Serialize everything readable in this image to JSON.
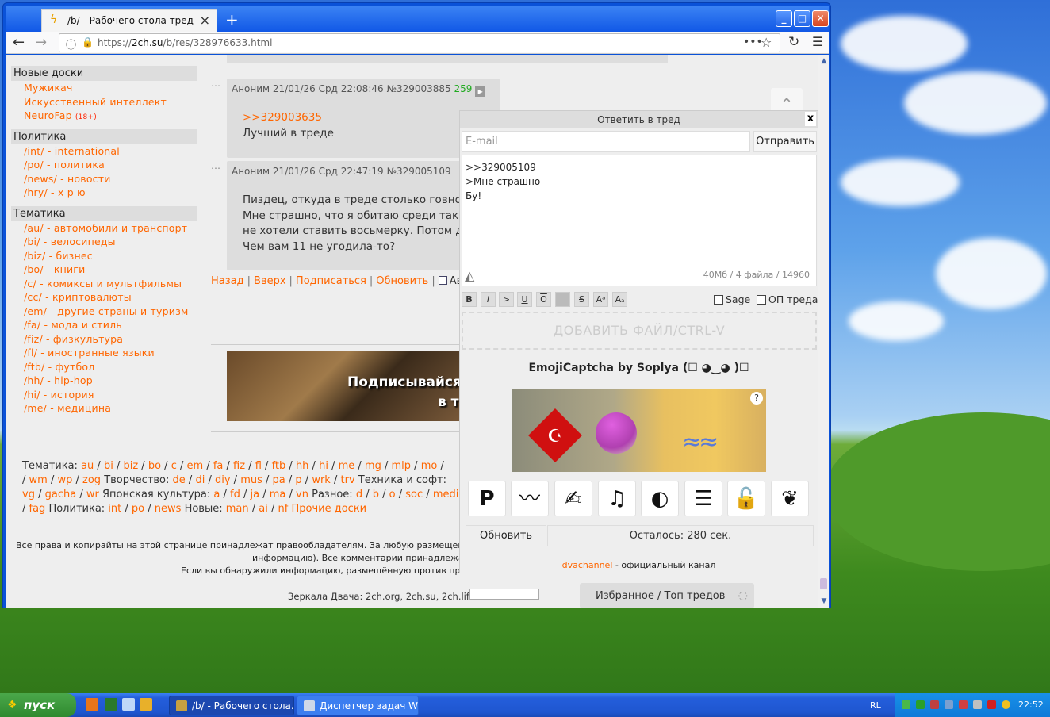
{
  "browser": {
    "tab_title": "/b/ - Рабочего стола тред",
    "url_prefix": "https://",
    "url_host": "2ch.su",
    "url_path": "/b/res/328976633.html"
  },
  "sidebar": {
    "sections": [
      {
        "title": "Новые доски",
        "items": [
          "Мужикач",
          "Искусственный интеллект",
          "NeuroFap"
        ],
        "badge": "(18+)"
      },
      {
        "title": "Политика",
        "items": [
          "/int/ - international",
          "/po/ - политика",
          "/news/ - новости",
          "/hry/ - х р ю"
        ]
      },
      {
        "title": "Тематика",
        "items": [
          "/au/ - автомобили и транспорт",
          "/bi/ - велосипеды",
          "/biz/ - бизнес",
          "/bo/ - книги",
          "/c/ - комиксы и мультфильмы",
          "/cc/ - криптовалюты",
          "/em/ - другие страны и туризм",
          "/fa/ - мода и стиль",
          "/fiz/ - физкультура",
          "/fl/ - иностранные языки",
          "/ftb/ - футбол",
          "/hh/ - hip-hop",
          "/hi/ - история",
          "/me/ - медицина"
        ]
      }
    ]
  },
  "posts": [
    {
      "author": "Аноним",
      "date": "21/01/26 Срд 22:08:46",
      "num": "№329003885",
      "ordinal": "259",
      "reply_link": ">>329003635",
      "text": "Лучший в треде"
    },
    {
      "author": "Аноним",
      "date": "21/01/26 Срд 22:47:19",
      "num": "№329005109",
      "lines": [
        "Пиздец, откуда в треде столько говно",
        "Мне страшно, что я обитаю среди таки",
        "не хотели ставить восьмерку. Потом д",
        "Чем вам 11 не угодила-то?"
      ]
    }
  ],
  "thread_nav": [
    "Назад",
    "Вверх",
    "Подписаться",
    "Обновить",
    "Авт"
  ],
  "banner": {
    "line1": "Подписывайся",
    "line2": "в т"
  },
  "boards_footer": {
    "line1_label": "Тематика:",
    "line1": [
      "au",
      "bi",
      "biz",
      "bo",
      "c",
      "em",
      "fa",
      "fiz",
      "fl",
      "ftb",
      "hh",
      "hi",
      "me",
      "mg",
      "mlp",
      "mo"
    ],
    "line2": [
      "wm",
      "wp",
      "zog"
    ],
    "creative_label": "Творчество:",
    "creative": [
      "de",
      "di",
      "diy",
      "mus",
      "pa",
      "p",
      "wrk",
      "trv"
    ],
    "tech_label": "Техника и софт:",
    "line3": [
      "vg",
      "gacha",
      "wr"
    ],
    "japan_label": "Японская культура:",
    "japan": [
      "a",
      "fd",
      "ja",
      "ma",
      "vn"
    ],
    "misc_label": "Разное:",
    "misc": [
      "d",
      "b",
      "o",
      "soc",
      "medi"
    ],
    "line4": [
      "fag"
    ],
    "politics_label": "Политика:",
    "politics": [
      "int",
      "po",
      "news"
    ],
    "new_label": "Новые:",
    "new": [
      "man",
      "ai",
      "nf"
    ],
    "other": "Прочие доски"
  },
  "footer": {
    "line1": "Все права и копирайты на этой странице принадлежат правообладателям. За любую размещенну",
    "line2": "информацию). Все комментарии принадлежат",
    "line3": "Если вы обнаружили информацию, размещённую против прав",
    "mirrors": "Зеркала Двача: 2ch.org, 2ch.su, 2ch.life",
    "fav": "Избранное / Топ тредов"
  },
  "reply_form": {
    "title": "Ответить в тред",
    "email_placeholder": "E-mail",
    "send": "Отправить",
    "message": ">>329005109\n>Мне страшно\nБу!",
    "counter": "40Мб / 4 файла / 14960",
    "sage": "Sage",
    "op": "ОП треда",
    "add_file": "ДОБАВИТЬ ФАЙЛ/CTRL-V",
    "captcha_title": "EmojiCaptcha by Soplya (☐ ◕‿◕ )☐",
    "update": "Обновить",
    "remaining": "Осталось: 280 сек.",
    "channel_link": "dvachannel",
    "channel_text": " - официальный канал"
  },
  "taskbar": {
    "start": "пуск",
    "tasks": [
      "/b/ - Рабочего стола...",
      "Диспетчер задач Wi..."
    ],
    "lang": "RL",
    "clock": "22:52"
  }
}
